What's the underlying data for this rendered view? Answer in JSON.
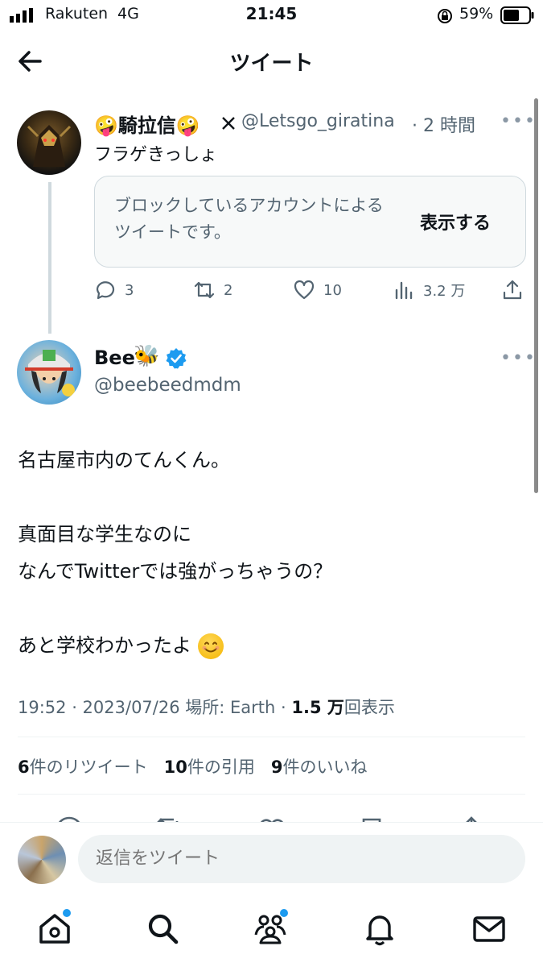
{
  "status": {
    "carrier": "Rakuten",
    "network": "4G",
    "time": "21:45",
    "battery": "59%"
  },
  "header": {
    "title": "ツイート"
  },
  "parent_tweet": {
    "name": "🤪騎拉信🤪",
    "handle": "@Letsgo_giratina",
    "time": "· 2 時間",
    "text": "フラゲきっしょ",
    "blocked_notice": "ブロックしているアカウントによるツイートです。",
    "show_label": "表示する",
    "replies": "3",
    "retweets": "2",
    "likes": "10",
    "views": "3.2 万"
  },
  "main_tweet": {
    "name": "Bee",
    "bee_emoji": "🐝",
    "handle": "@beebeedmdm",
    "lines": [
      "名古屋市内のてんくん。",
      "",
      "真面目な学生なのに",
      "なんでTwitterでは強がっちゃうの？",
      "",
      "あと学校わかったよ"
    ],
    "meta_prefix": "19:52 · 2023/07/26 場所: Earth · ",
    "meta_views": "1.5 万",
    "meta_suffix": "回表示",
    "retweet_count": "6",
    "retweet_label": "件のリツイート",
    "quote_count": "10",
    "quote_label": "件の引用",
    "like_count": "9",
    "like_label": "件のいいね"
  },
  "reply": {
    "placeholder": "返信をツイート"
  },
  "colors": {
    "accent": "#1d9bf0",
    "text": "#0f1419",
    "muted": "#536471"
  }
}
